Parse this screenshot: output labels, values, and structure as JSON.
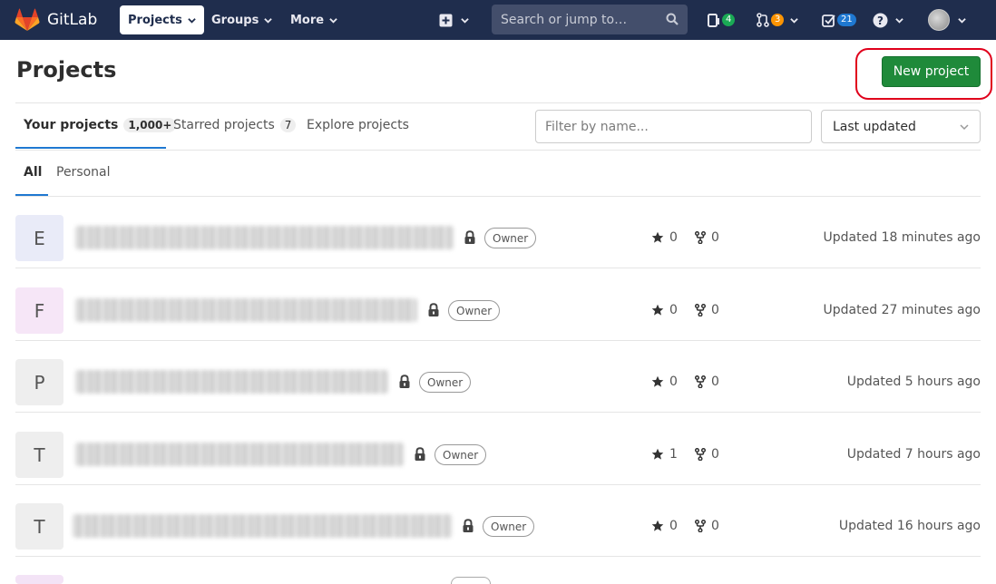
{
  "navbar": {
    "brand": "GitLab",
    "menus": [
      {
        "label": "Projects",
        "active": true
      },
      {
        "label": "Groups",
        "active": false
      },
      {
        "label": "More",
        "active": false
      }
    ],
    "search_placeholder": "Search or jump to…",
    "issues_count": "4",
    "merge_requests_count": "3",
    "todos_count": "21"
  },
  "header": {
    "title": "Projects",
    "new_project_label": "New project"
  },
  "tabs": [
    {
      "label": "Your projects",
      "count": "1,000+",
      "active": true
    },
    {
      "label": "Starred projects",
      "count": "7",
      "active": false
    },
    {
      "label": "Explore projects",
      "count": "",
      "active": false
    }
  ],
  "filter": {
    "placeholder": "Filter by name...",
    "sort_value": "Last updated"
  },
  "subtabs": [
    {
      "label": "All",
      "active": true
    },
    {
      "label": "Personal",
      "active": false
    }
  ],
  "projects": [
    {
      "initial": "E",
      "avatar_color": "#e9ebf8",
      "role": "Owner",
      "stars": "0",
      "forks": "0",
      "updated": "Updated 18 minutes ago"
    },
    {
      "initial": "F",
      "avatar_color": "#f6e6f7",
      "role": "Owner",
      "stars": "0",
      "forks": "0",
      "updated": "Updated 27 minutes ago"
    },
    {
      "initial": "P",
      "avatar_color": "#eeeeee",
      "role": "Owner",
      "stars": "0",
      "forks": "0",
      "updated": "Updated 5 hours ago"
    },
    {
      "initial": "T",
      "avatar_color": "#eeeeee",
      "role": "Owner",
      "stars": "1",
      "forks": "0",
      "updated": "Updated 7 hours ago"
    },
    {
      "initial": "T",
      "avatar_color": "#eeeeee",
      "role": "Owner",
      "stars": "0",
      "forks": "0",
      "updated": "Updated 16 hours ago"
    }
  ],
  "colors": {
    "navbar_bg": "#1f2d4d",
    "primary_green": "#1f8a3a",
    "highlight_red": "#e0001b",
    "tab_underline": "#1f78d1",
    "issues_badge": "#1aaa55",
    "mr_badge": "#fc9403",
    "todos_badge": "#1f78d1"
  }
}
